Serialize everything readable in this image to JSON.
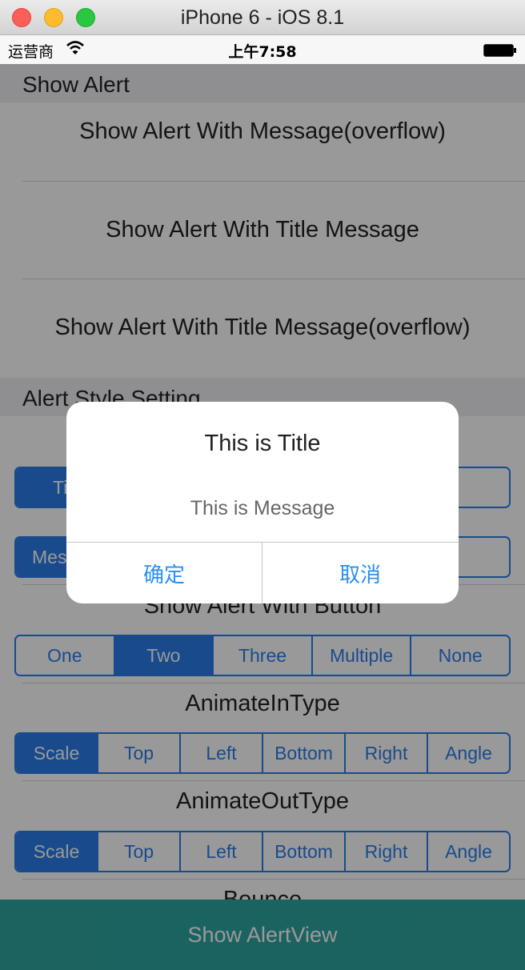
{
  "window": {
    "title": "iPhone 6 - iOS 8.1"
  },
  "status_bar": {
    "carrier": "运营商",
    "time": "上午7:58",
    "wifi_icon": "wifi-icon",
    "battery_icon": "battery-icon"
  },
  "section_show_alert": {
    "header": "Show Alert",
    "rows": [
      "Show Alert With Message(overflow)",
      "Show Alert With Title Message",
      "Show Alert With Title Message(overflow)"
    ]
  },
  "section_style": {
    "header": "Alert Style Setting",
    "title_segment": {
      "visible_left": "Ti"
    },
    "message_segment": {
      "visible_left": "Mes"
    },
    "button_label": "Show Alert With Button",
    "button_options": [
      "One",
      "Two",
      "Three",
      "Multiple",
      "None"
    ],
    "button_selected": "Two",
    "animate_in_label": "AnimateInType",
    "animate_in_options": [
      "Scale",
      "Top",
      "Left",
      "Bottom",
      "Right",
      "Angle"
    ],
    "animate_in_selected": "Scale",
    "animate_out_label": "AnimateOutType",
    "animate_out_options": [
      "Scale",
      "Top",
      "Left",
      "Bottom",
      "Right",
      "Angle"
    ],
    "animate_out_selected": "Scale",
    "bounce_label": "Bounce"
  },
  "bottom_button": "Show AlertView",
  "alert": {
    "title": "This is Title",
    "message": "This is Message",
    "confirm": "确定",
    "cancel": "取消"
  },
  "colors": {
    "accent": "#2b7de9",
    "bottom_button": "#2ea5a0",
    "alert_button_text": "#2b8ff0"
  }
}
